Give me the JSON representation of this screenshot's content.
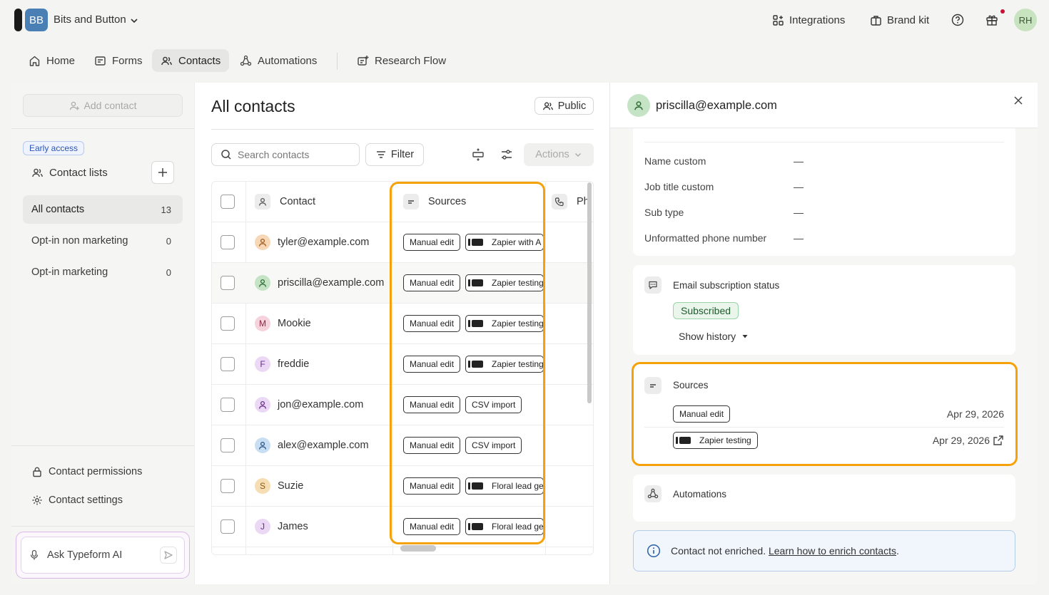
{
  "workspace": {
    "initials": "BB",
    "name": "Bits and Button"
  },
  "topbar": {
    "integrations": "Integrations",
    "brand_kit": "Brand kit",
    "user_initials": "RH"
  },
  "nav": {
    "home": "Home",
    "forms": "Forms",
    "contacts": "Contacts",
    "automations": "Automations",
    "research_flow": "Research Flow"
  },
  "sidebar": {
    "add_contact": "Add contact",
    "early_access": "Early access",
    "contact_lists": "Contact lists",
    "lists": [
      {
        "label": "All contacts",
        "count": "13"
      },
      {
        "label": "Opt-in non marketing",
        "count": "0"
      },
      {
        "label": "Opt-in marketing",
        "count": "0"
      }
    ],
    "contact_permissions": "Contact permissions",
    "contact_settings": "Contact settings",
    "ask_ai": "Ask Typeform AI"
  },
  "content": {
    "title": "All contacts",
    "public": "Public",
    "search_placeholder": "Search contacts",
    "filter": "Filter",
    "actions": "Actions",
    "columns": {
      "contact": "Contact",
      "sources": "Sources",
      "phone": "Ph"
    },
    "rows": [
      {
        "name": "tyler@example.com",
        "avatar": "",
        "tag1": "Manual edit",
        "tag2": "Zapier with A"
      },
      {
        "name": "priscilla@example.com",
        "avatar": "",
        "tag1": "Manual edit",
        "tag2": "Zapier testing"
      },
      {
        "name": "Mookie",
        "avatar": "M",
        "tag1": "Manual edit",
        "tag2": "Zapier testing"
      },
      {
        "name": "freddie",
        "avatar": "F",
        "tag1": "Manual edit",
        "tag2": "Zapier testing"
      },
      {
        "name": "jon@example.com",
        "avatar": "",
        "tag1": "Manual edit",
        "tag2": "CSV import"
      },
      {
        "name": "alex@example.com",
        "avatar": "",
        "tag1": "Manual edit",
        "tag2": "CSV import"
      },
      {
        "name": "Suzie",
        "avatar": "S",
        "tag1": "Manual edit",
        "tag2": "Floral lead ge"
      },
      {
        "name": "James",
        "avatar": "J",
        "tag1": "Manual edit",
        "tag2": "Floral lead ge"
      }
    ]
  },
  "detail": {
    "email": "priscilla@example.com",
    "fields": [
      {
        "label": "Name custom",
        "value": "—"
      },
      {
        "label": "Job title custom",
        "value": "—"
      },
      {
        "label": "Sub type",
        "value": "—"
      },
      {
        "label": "Unformatted phone number",
        "value": "—"
      }
    ],
    "email_sub_title": "Email subscription status",
    "email_sub_status": "Subscribed",
    "show_history": "Show history",
    "sources_title": "Sources",
    "sources": [
      {
        "label": "Manual edit",
        "date": "Apr 29, 2026"
      },
      {
        "label": "Zapier testing",
        "date": "Apr 29, 2026"
      }
    ],
    "automations_title": "Automations",
    "info_text": "Contact not enriched.",
    "info_link": "Learn how to enrich contacts",
    "info_end": "."
  },
  "colors": {
    "highlight": "#f5a20a",
    "workspace_avatar": "#4a7fb5",
    "subscribed_bg": "#eaf6ec"
  }
}
